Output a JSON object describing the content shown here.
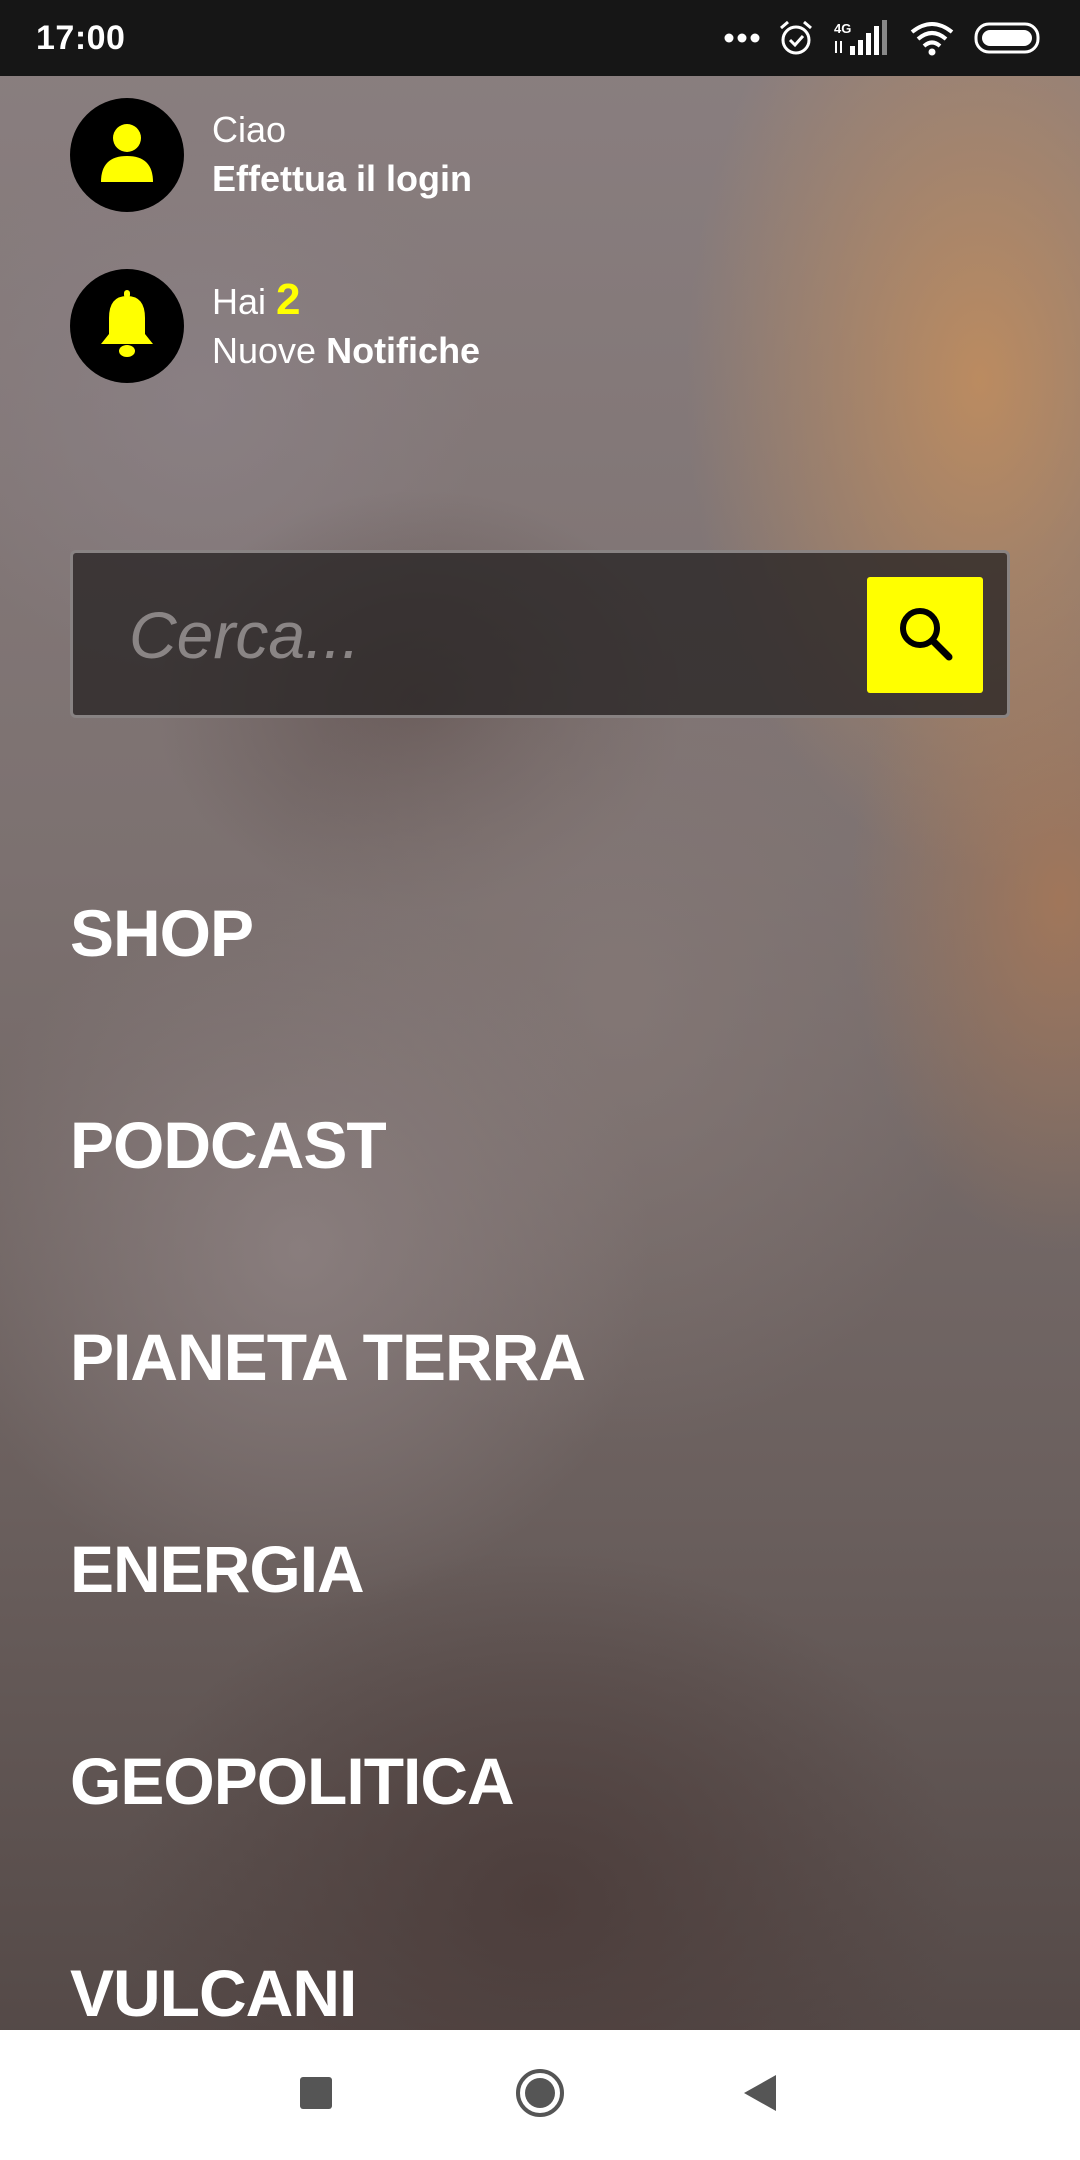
{
  "status_bar": {
    "time": "17:00",
    "network_label": "4G",
    "icons": [
      "more-dots-icon",
      "alarm-icon",
      "signal-icon",
      "wifi-icon",
      "battery-icon"
    ]
  },
  "account": {
    "greeting": "Ciao",
    "login_prompt": "Effettua il login",
    "icon": "user-icon"
  },
  "notifications": {
    "prefix": "Hai",
    "count": "2",
    "new_label": "Nuove",
    "notifications_label": "Notifiche",
    "icon": "bell-icon"
  },
  "search": {
    "placeholder": "Cerca...",
    "value": "",
    "icon": "search-icon"
  },
  "menu": {
    "items": [
      {
        "label": "SHOP"
      },
      {
        "label": "PODCAST"
      },
      {
        "label": "PIANETA TERRA"
      },
      {
        "label": "ENERGIA"
      },
      {
        "label": "GEOPOLITICA"
      },
      {
        "label": "VULCANI"
      }
    ]
  },
  "nav_bar": {
    "icons": [
      "recent-apps-icon",
      "home-icon",
      "back-icon"
    ]
  },
  "colors": {
    "accent": "#ffff00",
    "status_bar": "#161616",
    "text": "#ffffff",
    "nav_bar": "#ffffff"
  }
}
